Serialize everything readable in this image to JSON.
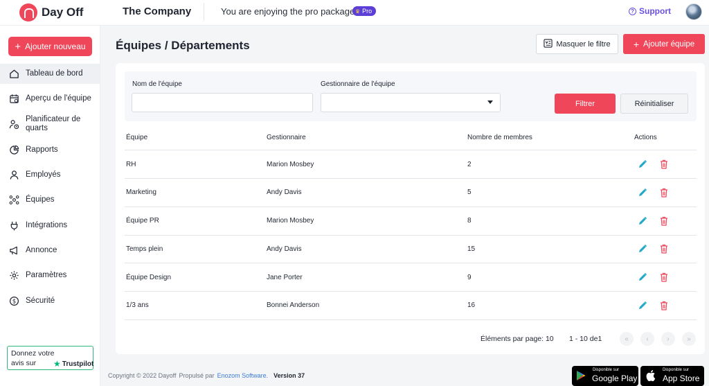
{
  "header": {
    "logo_text": "Day Off",
    "company": "The Company",
    "pro_message": "You are enjoying the pro package",
    "pro_badge": "Pro",
    "support_label": "Support"
  },
  "sidebar": {
    "add_new_label": "Ajouter nouveau",
    "items": [
      {
        "label": "Tableau de bord",
        "icon": "home-icon"
      },
      {
        "label": "Aperçu de l'équipe",
        "icon": "calendar-icon"
      },
      {
        "label": "Planificateur de quarts",
        "icon": "person-clock-icon"
      },
      {
        "label": "Rapports",
        "icon": "pie-chart-icon"
      },
      {
        "label": "Employés",
        "icon": "user-icon"
      },
      {
        "label": "Équipes",
        "icon": "team-icon"
      },
      {
        "label": "Intégrations",
        "icon": "plug-icon"
      },
      {
        "label": "Annonce",
        "icon": "megaphone-icon"
      },
      {
        "label": "Paramètres",
        "icon": "gear-icon"
      },
      {
        "label": "Sécurité",
        "icon": "dollar-shield-icon"
      }
    ],
    "trustpilot": {
      "line1": "Donnez votre",
      "line2": "avis sur",
      "brand": "Trustpilot"
    }
  },
  "main": {
    "title": "Équipes / Départements",
    "hide_filter_label": "Masquer le filtre",
    "add_team_label": "Ajouter équipe",
    "filters": {
      "team_name_label": "Nom de l'équipe",
      "team_name_value": "",
      "manager_label": "Gestionnaire de l'équipe",
      "manager_value": "",
      "filter_button": "Filtrer",
      "reset_button": "Réinitialiser"
    },
    "table": {
      "headers": [
        "Équipe",
        "Gestionnaire",
        "Nombre de membres",
        "Actions"
      ],
      "rows": [
        {
          "team": "RH",
          "manager": "Marion Mosbey",
          "members": "2"
        },
        {
          "team": "Marketing",
          "manager": "Andy Davis",
          "members": "5"
        },
        {
          "team": "Équipe PR",
          "manager": "Marion Mosbey",
          "members": "8"
        },
        {
          "team": "Temps plein",
          "manager": "Andy Davis",
          "members": "15"
        },
        {
          "team": "Équipe Design",
          "manager": "Jane Porter",
          "members": "9"
        },
        {
          "team": "1/3 ans",
          "manager": "Bonnei Anderson",
          "members": "16"
        }
      ]
    },
    "pagination": {
      "per_page": "Éléments par page: 10",
      "range": "1 - 10 de1",
      "first": "«",
      "prev": "‹",
      "next": "›",
      "last": "»"
    }
  },
  "footer": {
    "copyright": "Copyright © 2022 Dayoff",
    "powered": "Propulsé par",
    "powered_link": "Enozom Software.",
    "version": "Version 37",
    "google_small": "Disponible sur",
    "google_big": "Google Play",
    "apple_small": "Disponible sur",
    "apple_big": "App Store"
  },
  "colors": {
    "accent": "#f0465a",
    "purple": "#6a4fe0",
    "edit": "#22a8c9"
  }
}
